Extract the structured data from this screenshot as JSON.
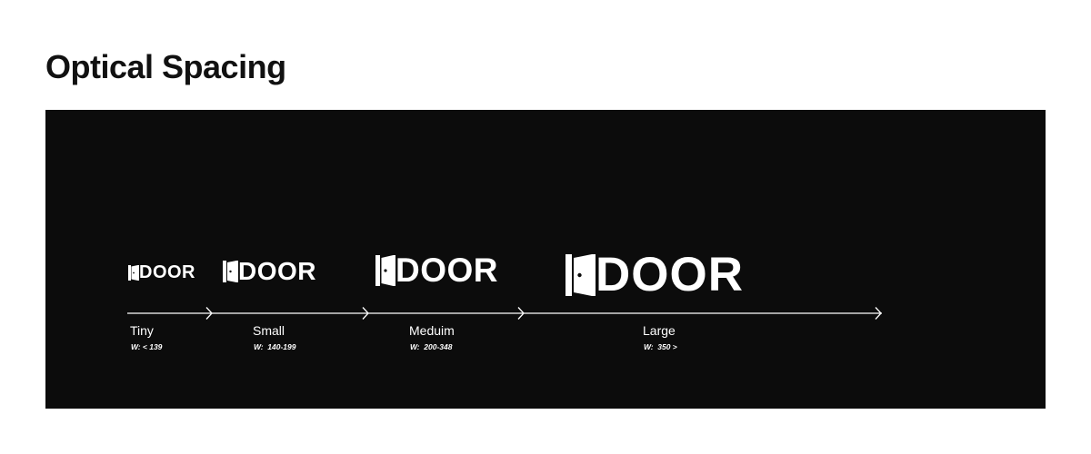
{
  "header": {
    "title": "Optical Spacing"
  },
  "colors": {
    "panel_background": "#0c0c0c",
    "foreground": "#ffffff",
    "title_text": "#111111"
  },
  "logo": {
    "wordmark": "DOOR",
    "icon": "door-icon"
  },
  "tiers": [
    {
      "label": "Tiny",
      "width_range": "W: < 139"
    },
    {
      "label": "Small",
      "width_range": "W:  140-199"
    },
    {
      "label": "Meduim",
      "width_range": "W:  200-348"
    },
    {
      "label": "Large",
      "width_range": "W:  350 >"
    }
  ]
}
